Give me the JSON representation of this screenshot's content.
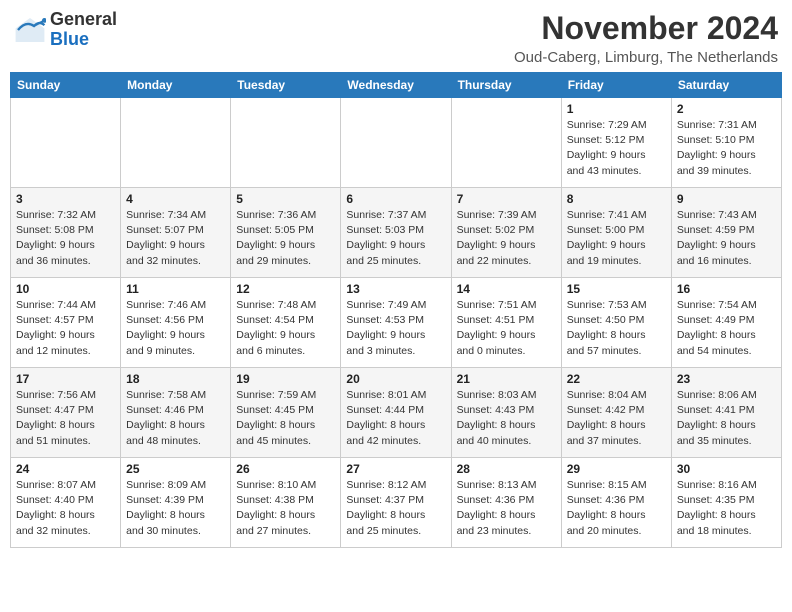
{
  "header": {
    "logo_general": "General",
    "logo_blue": "Blue",
    "month": "November 2024",
    "location": "Oud-Caberg, Limburg, The Netherlands"
  },
  "weekdays": [
    "Sunday",
    "Monday",
    "Tuesday",
    "Wednesday",
    "Thursday",
    "Friday",
    "Saturday"
  ],
  "weeks": [
    [
      {
        "day": "",
        "info": ""
      },
      {
        "day": "",
        "info": ""
      },
      {
        "day": "",
        "info": ""
      },
      {
        "day": "",
        "info": ""
      },
      {
        "day": "",
        "info": ""
      },
      {
        "day": "1",
        "info": "Sunrise: 7:29 AM\nSunset: 5:12 PM\nDaylight: 9 hours and 43 minutes."
      },
      {
        "day": "2",
        "info": "Sunrise: 7:31 AM\nSunset: 5:10 PM\nDaylight: 9 hours and 39 minutes."
      }
    ],
    [
      {
        "day": "3",
        "info": "Sunrise: 7:32 AM\nSunset: 5:08 PM\nDaylight: 9 hours and 36 minutes."
      },
      {
        "day": "4",
        "info": "Sunrise: 7:34 AM\nSunset: 5:07 PM\nDaylight: 9 hours and 32 minutes."
      },
      {
        "day": "5",
        "info": "Sunrise: 7:36 AM\nSunset: 5:05 PM\nDaylight: 9 hours and 29 minutes."
      },
      {
        "day": "6",
        "info": "Sunrise: 7:37 AM\nSunset: 5:03 PM\nDaylight: 9 hours and 25 minutes."
      },
      {
        "day": "7",
        "info": "Sunrise: 7:39 AM\nSunset: 5:02 PM\nDaylight: 9 hours and 22 minutes."
      },
      {
        "day": "8",
        "info": "Sunrise: 7:41 AM\nSunset: 5:00 PM\nDaylight: 9 hours and 19 minutes."
      },
      {
        "day": "9",
        "info": "Sunrise: 7:43 AM\nSunset: 4:59 PM\nDaylight: 9 hours and 16 minutes."
      }
    ],
    [
      {
        "day": "10",
        "info": "Sunrise: 7:44 AM\nSunset: 4:57 PM\nDaylight: 9 hours and 12 minutes."
      },
      {
        "day": "11",
        "info": "Sunrise: 7:46 AM\nSunset: 4:56 PM\nDaylight: 9 hours and 9 minutes."
      },
      {
        "day": "12",
        "info": "Sunrise: 7:48 AM\nSunset: 4:54 PM\nDaylight: 9 hours and 6 minutes."
      },
      {
        "day": "13",
        "info": "Sunrise: 7:49 AM\nSunset: 4:53 PM\nDaylight: 9 hours and 3 minutes."
      },
      {
        "day": "14",
        "info": "Sunrise: 7:51 AM\nSunset: 4:51 PM\nDaylight: 9 hours and 0 minutes."
      },
      {
        "day": "15",
        "info": "Sunrise: 7:53 AM\nSunset: 4:50 PM\nDaylight: 8 hours and 57 minutes."
      },
      {
        "day": "16",
        "info": "Sunrise: 7:54 AM\nSunset: 4:49 PM\nDaylight: 8 hours and 54 minutes."
      }
    ],
    [
      {
        "day": "17",
        "info": "Sunrise: 7:56 AM\nSunset: 4:47 PM\nDaylight: 8 hours and 51 minutes."
      },
      {
        "day": "18",
        "info": "Sunrise: 7:58 AM\nSunset: 4:46 PM\nDaylight: 8 hours and 48 minutes."
      },
      {
        "day": "19",
        "info": "Sunrise: 7:59 AM\nSunset: 4:45 PM\nDaylight: 8 hours and 45 minutes."
      },
      {
        "day": "20",
        "info": "Sunrise: 8:01 AM\nSunset: 4:44 PM\nDaylight: 8 hours and 42 minutes."
      },
      {
        "day": "21",
        "info": "Sunrise: 8:03 AM\nSunset: 4:43 PM\nDaylight: 8 hours and 40 minutes."
      },
      {
        "day": "22",
        "info": "Sunrise: 8:04 AM\nSunset: 4:42 PM\nDaylight: 8 hours and 37 minutes."
      },
      {
        "day": "23",
        "info": "Sunrise: 8:06 AM\nSunset: 4:41 PM\nDaylight: 8 hours and 35 minutes."
      }
    ],
    [
      {
        "day": "24",
        "info": "Sunrise: 8:07 AM\nSunset: 4:40 PM\nDaylight: 8 hours and 32 minutes."
      },
      {
        "day": "25",
        "info": "Sunrise: 8:09 AM\nSunset: 4:39 PM\nDaylight: 8 hours and 30 minutes."
      },
      {
        "day": "26",
        "info": "Sunrise: 8:10 AM\nSunset: 4:38 PM\nDaylight: 8 hours and 27 minutes."
      },
      {
        "day": "27",
        "info": "Sunrise: 8:12 AM\nSunset: 4:37 PM\nDaylight: 8 hours and 25 minutes."
      },
      {
        "day": "28",
        "info": "Sunrise: 8:13 AM\nSunset: 4:36 PM\nDaylight: 8 hours and 23 minutes."
      },
      {
        "day": "29",
        "info": "Sunrise: 8:15 AM\nSunset: 4:36 PM\nDaylight: 8 hours and 20 minutes."
      },
      {
        "day": "30",
        "info": "Sunrise: 8:16 AM\nSunset: 4:35 PM\nDaylight: 8 hours and 18 minutes."
      }
    ]
  ]
}
